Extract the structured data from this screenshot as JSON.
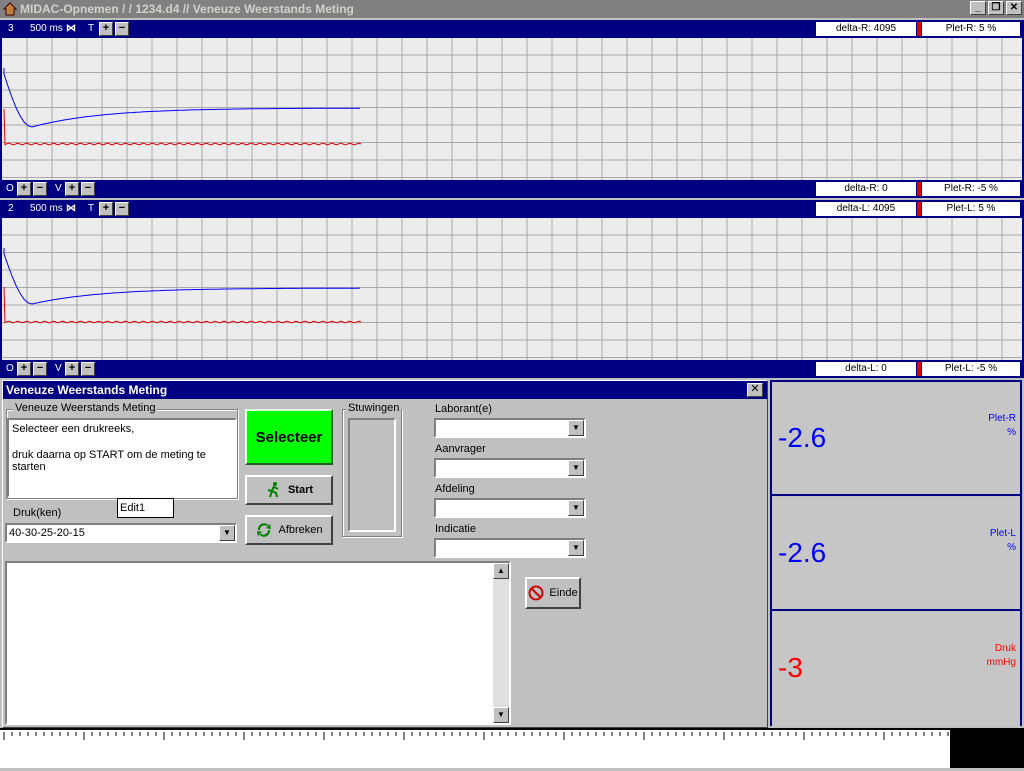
{
  "window": {
    "title": "MIDAC-Opnemen /  / 1234.d4 // Veneuze Weerstands Meting"
  },
  "channels": [
    {
      "id": "3",
      "timebase": "500 ms",
      "t_label": "T",
      "top_delta": "delta-R: 4095",
      "top_plet": "Plet-R: 5 %",
      "o_label": "O",
      "v_label": "V",
      "bottom_delta": "delta-R: 0",
      "bottom_plet": "Plet-R: -5 %"
    },
    {
      "id": "2",
      "timebase": "500 ms",
      "t_label": "T",
      "top_delta": "delta-L: 4095",
      "top_plet": "Plet-L: 5 %",
      "o_label": "O",
      "v_label": "V",
      "bottom_delta": "delta-L: 0",
      "bottom_plet": "Plet-L: -5 %"
    }
  ],
  "dialog": {
    "title": "Veneuze Weerstands Meting",
    "group_label": "Veneuze Weerstands Meting",
    "instruction_line1": "Selecteer een drukreeks,",
    "instruction_line2": "druk daarna op START om de meting te starten",
    "select_button": "Selecteer",
    "start_button": "Start",
    "abort_button": "Afbreken",
    "edit_field": "Edit1",
    "pressures_label": "Druk(ken)",
    "pressures_value": "40-30-25-20-15",
    "stuwingen_label": "Stuwingen",
    "laborant_label": "Laborant(e)",
    "aanvrager_label": "Aanvrager",
    "afdeling_label": "Afdeling",
    "indicatie_label": "Indicatie",
    "end_button": "Einde"
  },
  "meters": [
    {
      "value": "-2.6",
      "name": "Plet-R",
      "unit": "%",
      "color": "#0000ff"
    },
    {
      "value": "-2.6",
      "name": "Plet-L",
      "unit": "%",
      "color": "#0000ff"
    },
    {
      "value": "-3",
      "name": "Druk",
      "unit": "mmHg",
      "color": "#ff0000"
    }
  ],
  "colors": {
    "titlebar": "#808080",
    "channel_bar": "#000080",
    "select_button": "#00ff00",
    "trace_blue": "#0000ff",
    "trace_red": "#e00000"
  }
}
